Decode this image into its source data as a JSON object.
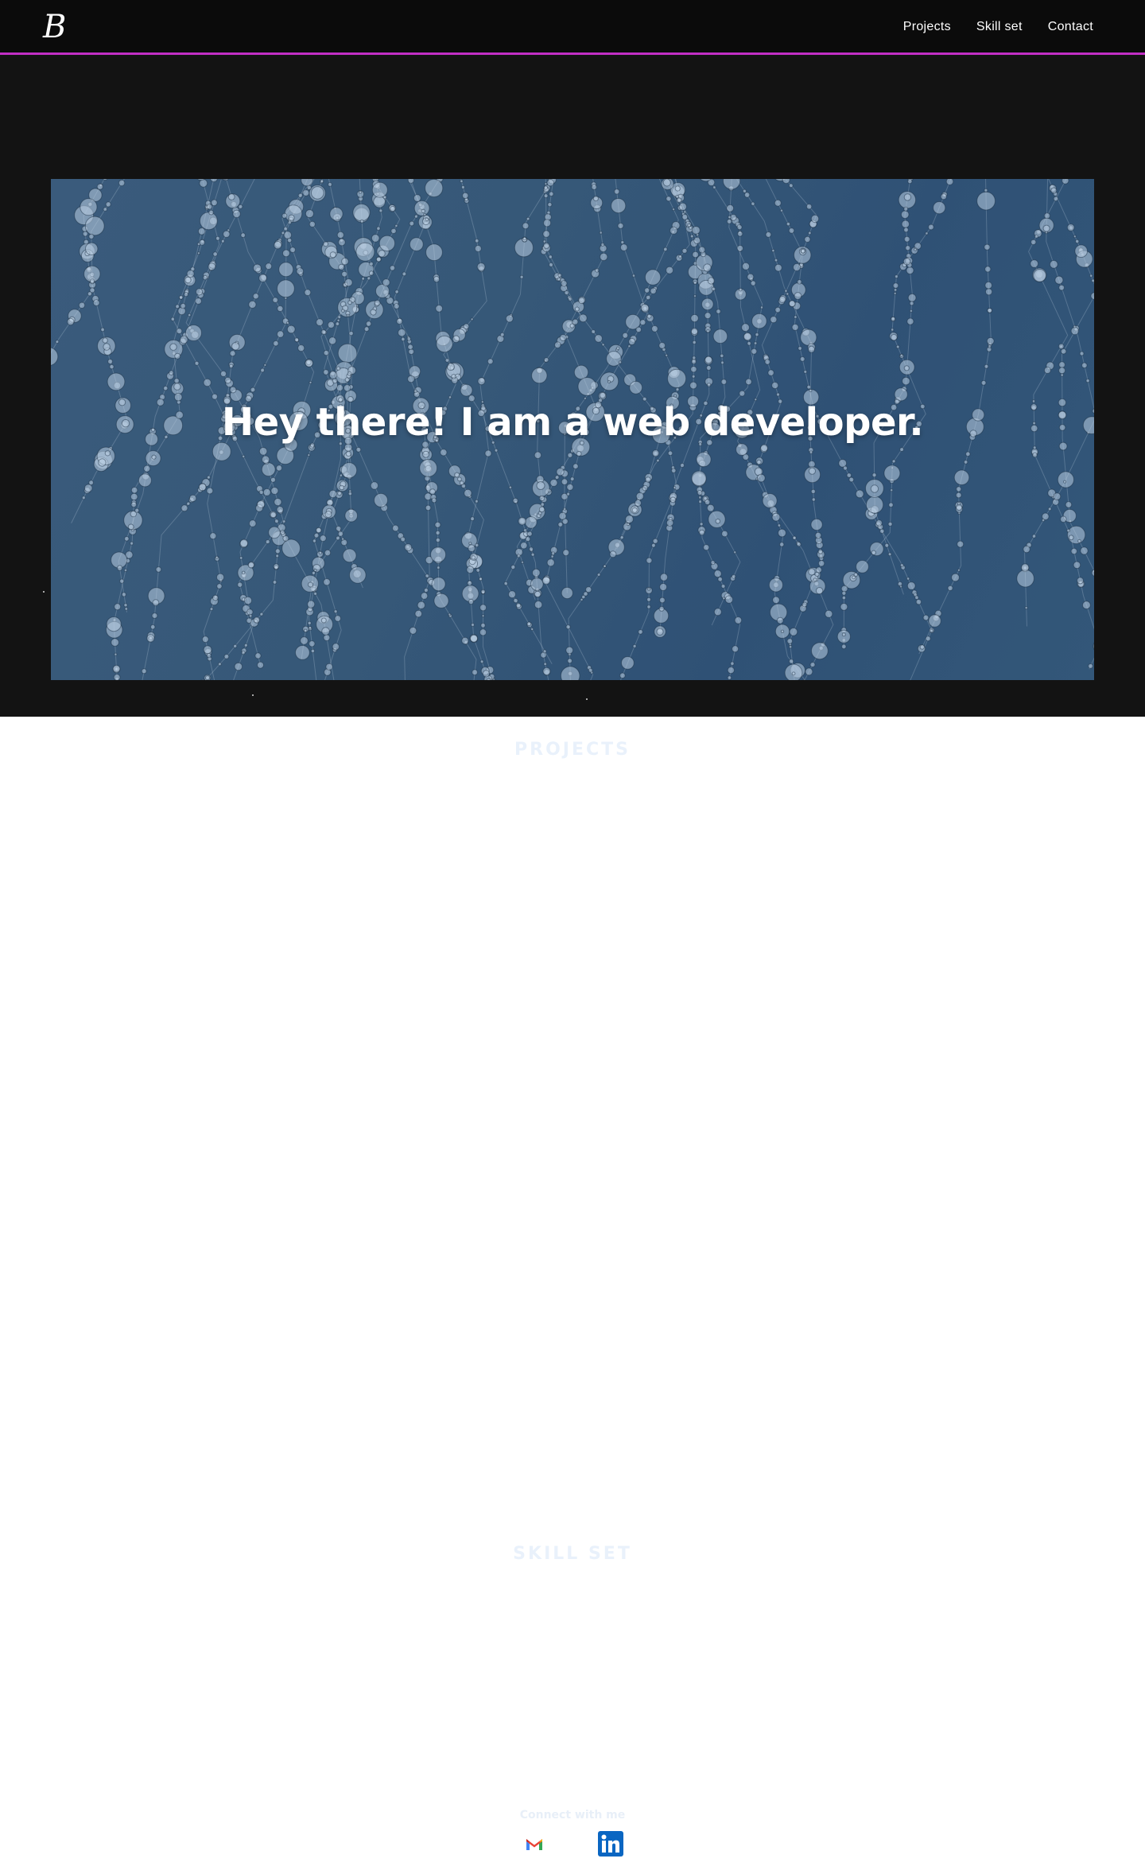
{
  "navbar": {
    "logo": "B",
    "links": [
      {
        "label": "Projects"
      },
      {
        "label": "Skill set"
      },
      {
        "label": "Contact"
      }
    ],
    "accent_color": "#c22fc6"
  },
  "hero": {
    "title": "Hey there! I am a web developer."
  },
  "sections": {
    "projects_title": "PROJECTS",
    "skills_title": "SKILL SET"
  },
  "footer": {
    "connect_label": "Connect with me",
    "social": [
      {
        "icon": "gmail-icon"
      },
      {
        "icon": "linkedin-icon"
      }
    ]
  }
}
